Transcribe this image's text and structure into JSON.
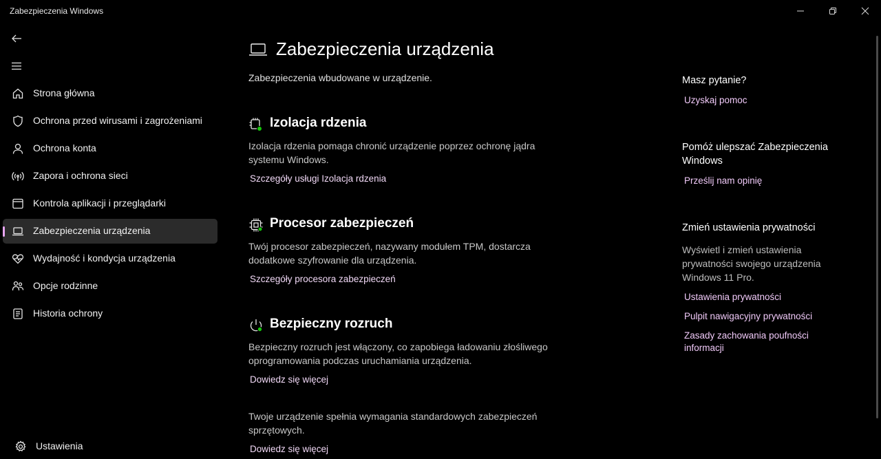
{
  "window": {
    "title": "Zabezpieczenia Windows"
  },
  "nav": {
    "items": [
      {
        "label": "Strona główna",
        "icon": "home-icon"
      },
      {
        "label": "Ochrona przed wirusami i zagrożeniami",
        "icon": "shield-icon"
      },
      {
        "label": "Ochrona konta",
        "icon": "person-icon"
      },
      {
        "label": "Zapora i ochrona sieci",
        "icon": "wireless-icon"
      },
      {
        "label": "Kontrola aplikacji i przeglądarki",
        "icon": "app-browser-icon"
      },
      {
        "label": "Zabezpieczenia urządzenia",
        "icon": "laptop-icon",
        "selected": true
      },
      {
        "label": "Wydajność i kondycja urządzenia",
        "icon": "heart-pulse-icon"
      },
      {
        "label": "Opcje rodzinne",
        "icon": "family-icon"
      },
      {
        "label": "Historia ochrony",
        "icon": "history-icon"
      }
    ],
    "settings_label": "Ustawienia"
  },
  "main": {
    "title": "Zabezpieczenia urządzenia",
    "subtitle": "Zabezpieczenia wbudowane w urządzenie.",
    "sections": [
      {
        "title": "Izolacja rdzenia",
        "description": "Izolacja rdzenia pomaga chronić urządzenie poprzez ochronę jądra systemu Windows.",
        "link": "Szczegóły usługi Izolacja rdzenia",
        "icon": "core-isolation-icon"
      },
      {
        "title": "Procesor zabezpieczeń",
        "description": "Twój procesor zabezpieczeń, nazywany modułem TPM, dostarcza dodatkowe szyfrowanie dla urządzenia.",
        "link": "Szczegóły procesora zabezpieczeń",
        "icon": "chip-icon"
      },
      {
        "title": "Bezpieczny rozruch",
        "description": "Bezpieczny rozruch jest włączony, co zapobiega ładowaniu złośliwego oprogramowania podczas uruchamiania urządzenia.",
        "link": "Dowiedz się więcej",
        "icon": "power-icon"
      }
    ],
    "footer_text": "Twoje urządzenie spełnia wymagania standardowych zabezpieczeń sprzętowych.",
    "footer_link": "Dowiedz się więcej"
  },
  "aside": {
    "question": {
      "heading": "Masz pytanie?",
      "link": "Uzyskaj pomoc"
    },
    "improve": {
      "heading": "Pomóż ulepszać Zabezpieczenia Windows",
      "link": "Prześlij nam opinię"
    },
    "privacy": {
      "heading": "Zmień ustawienia prywatności",
      "text": "Wyświetl i zmień ustawienia prywatności swojego urządzenia Windows 11 Pro.",
      "links": [
        "Ustawienia prywatności",
        "Pulpit nawigacyjny prywatności",
        "Zasady zachowania poufności informacji"
      ]
    }
  },
  "colors": {
    "background": "#000000",
    "accent": "#e8a6f5",
    "link": "#f0c9f8",
    "selected_bg": "#2b2b2b"
  }
}
